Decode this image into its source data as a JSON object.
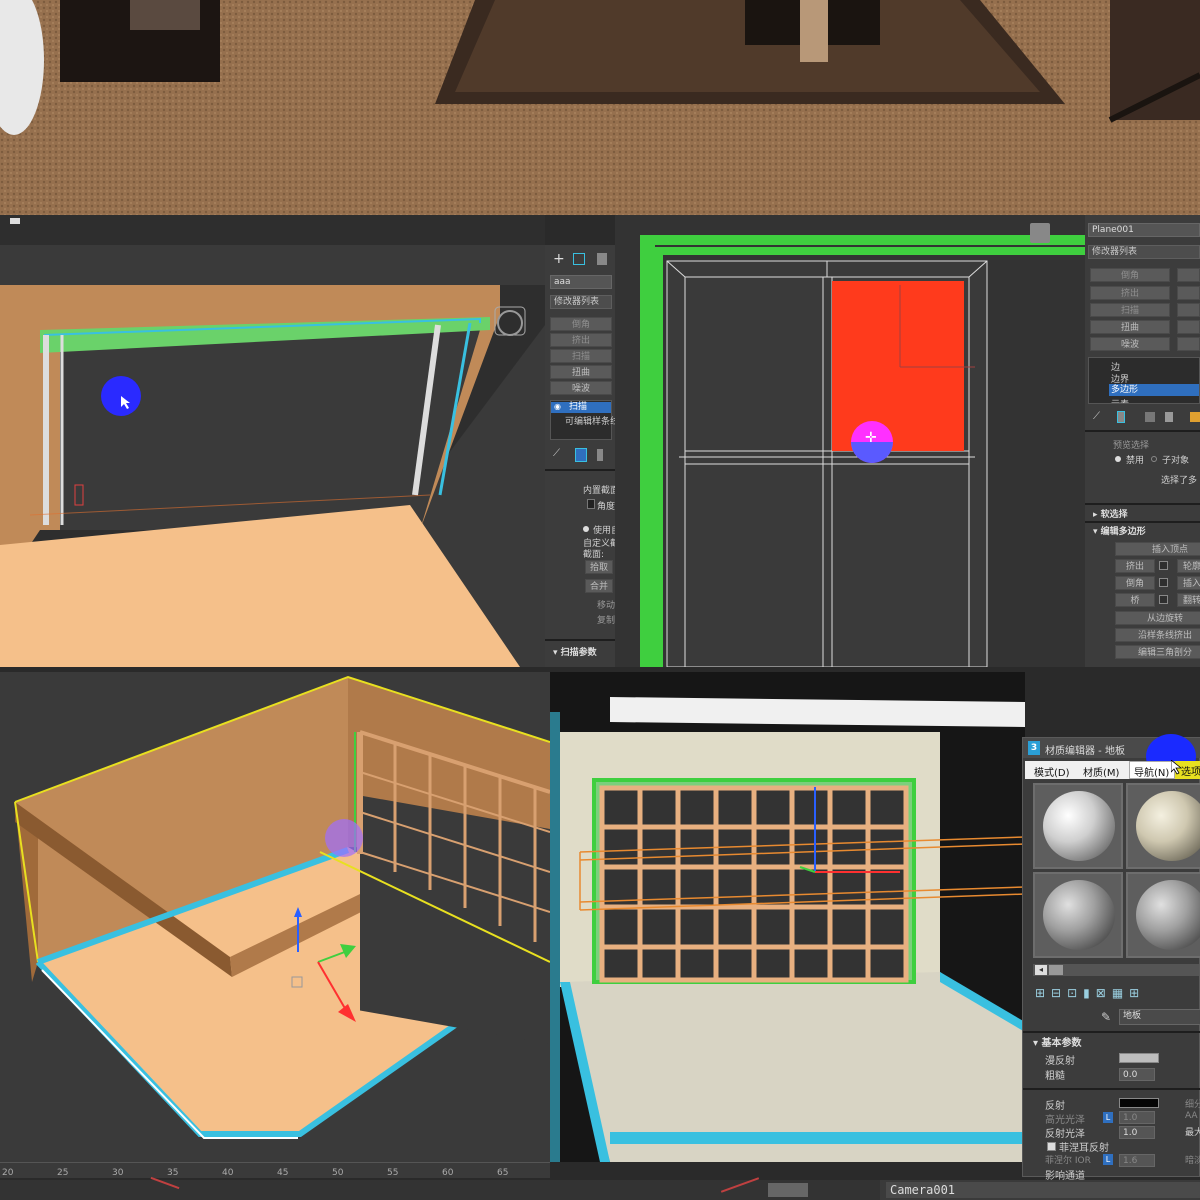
{
  "panel_tl": {
    "name_field": "aaa",
    "modifier_list": "修改器列表",
    "modifier_buttons": [
      "倒角",
      "挤出",
      "扫描",
      "扭曲",
      "噪波"
    ],
    "stack": [
      "扫描",
      "可编辑样条线"
    ],
    "section_builtin": "内置截面",
    "angle_label": "角度",
    "use_custom": "使用自",
    "custom_section": "自定义截",
    "section": "截面:",
    "pick_btn": "拾取",
    "merge_btn": "合并",
    "move_label": "移动",
    "copy_label": "复制",
    "sweep_params": "扫描参数"
  },
  "panel_tr": {
    "object_name": "Plane001",
    "modifier_list": "修改器列表",
    "modifier_buttons": [
      "倒角",
      "挤出",
      "扫描",
      "扭曲",
      "噪波"
    ],
    "sublevels": [
      "边",
      "边界",
      "多边形",
      "元素"
    ],
    "disable_label": "禁用",
    "child_label": "子对象",
    "selected_text": "选择了多",
    "soft_selection": "软选择",
    "edit_poly": "编辑多边形",
    "insert_vertex": "插入顶点",
    "extrude": "挤出",
    "outline": "轮廓",
    "bevel": "倒角",
    "inset": "插入",
    "bridge": "桥",
    "flip": "翻转",
    "hinge": "从边旋转",
    "extrude_along_spline": "沿样条线挤出",
    "edit_triangulation": "编辑三角剖分",
    "preview_selection": "预览选择"
  },
  "material_editor": {
    "title": "材质编辑器 - 地板",
    "badge": "3",
    "menus": [
      "模式(D)",
      "材质(M)",
      "导航(N)",
      "选项"
    ],
    "material_name": "地板",
    "basic_params": "基本参数",
    "diffuse": "漫反射",
    "roughness": "粗糙",
    "roughness_value": "0.0",
    "reflection": "反射",
    "highlight_gloss": "高光光泽",
    "highlight_gloss_value": "1.0",
    "reflect_gloss": "反射光泽",
    "reflect_gloss_value": "1.0",
    "fresnel": "菲涅耳反射",
    "fresnel_ior": "菲涅尔 IOR",
    "fresnel_ior_value": "1.6",
    "affect_channels": "影响通道",
    "l_badge": "L",
    "right_col": [
      "细分",
      "AA",
      "最大",
      "暗淡"
    ]
  },
  "ruler": {
    "labels": [
      "20",
      "25",
      "30",
      "35",
      "40",
      "45",
      "50",
      "55",
      "60",
      "65"
    ]
  },
  "bottom_strip": {
    "camera_label": "Camera001"
  },
  "colors": {
    "viewport_bg": "#3a3a3a",
    "floor": "#f5c08a",
    "wall": "#c08a58",
    "green_frame": "#3fcf3f",
    "cyan": "#39c0e0",
    "red_panel": "#ff3a1c",
    "yellow": "#e8e020",
    "cursor_blue": "#2a2aff",
    "cursor_magenta": "#ff30ff"
  }
}
